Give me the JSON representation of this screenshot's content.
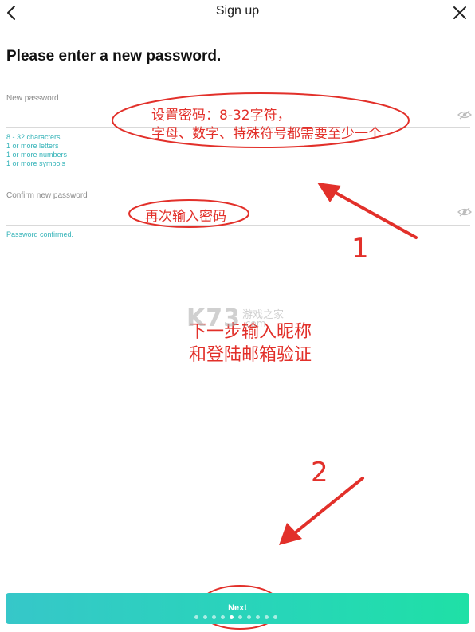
{
  "header": {
    "title": "Sign up",
    "back_icon": "chevron-left-icon",
    "close_icon": "close-icon"
  },
  "heading": "Please enter a new password.",
  "password_field": {
    "label": "New password",
    "value": "",
    "toggle_icon": "eye-off-icon"
  },
  "requirements": [
    "8 - 32 characters",
    "1 or more letters",
    "1 or more numbers",
    "1 or more symbols"
  ],
  "confirm_field": {
    "label": "Confirm new password",
    "value": "",
    "toggle_icon": "eye-off-icon",
    "status": "Password confirmed."
  },
  "annotations": {
    "password_note_line1": "设置密码：8-32字符，",
    "password_note_line2": "字母、数字、特殊符号都需要至少一个",
    "confirm_note": "再次输入密码",
    "step_1": "1",
    "step_2": "2",
    "next_step_line1": "下一步输入昵称",
    "next_step_line2": "和登陆邮箱验证"
  },
  "watermark": {
    "logo": "K73",
    "cn": "游戏之家",
    "domain": ".com"
  },
  "footer": {
    "next_label": "Next",
    "progress_total": 10,
    "progress_current": 4
  },
  "colors": {
    "accent_teal": "#34b3b8",
    "button_start": "#36c7c9",
    "button_end": "#1fe0a6",
    "annotation_red": "#e2302a"
  }
}
